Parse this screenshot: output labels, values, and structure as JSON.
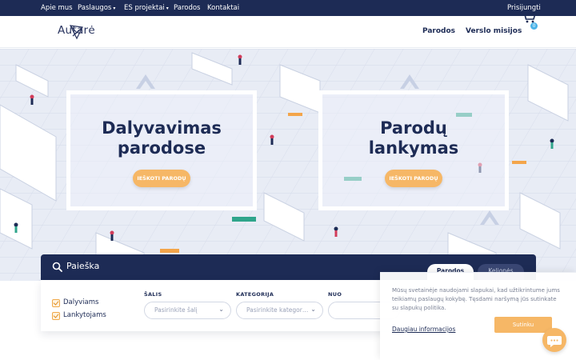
{
  "topbar": {
    "items": [
      {
        "label": "Apie mus",
        "dropdown": false
      },
      {
        "label": "Paslaugos",
        "dropdown": true
      },
      {
        "label": "ES projektai",
        "dropdown": true
      },
      {
        "label": "Parodos",
        "dropdown": false
      },
      {
        "label": "Kontaktai",
        "dropdown": false
      }
    ],
    "login": "Prisijungti"
  },
  "header": {
    "logo_text": "Autarė",
    "nav": [
      {
        "label": "Parodos"
      },
      {
        "label": "Verslo misijos"
      }
    ],
    "cart_count": "0"
  },
  "hero": {
    "cards": [
      {
        "title_line1": "Dalyvavimas",
        "title_line2": "parodose",
        "button": "IEŠKOTI PARODŲ"
      },
      {
        "title_line1": "Parodų",
        "title_line2": "lankymas",
        "button": "IEŠKOTI PARODŲ"
      }
    ]
  },
  "search": {
    "title": "Paieška",
    "tabs": [
      {
        "label": "Parodos",
        "active": true
      },
      {
        "label": "Kelionės",
        "active": false
      }
    ],
    "checkboxes": [
      {
        "label": "Dalyviams",
        "checked": true
      },
      {
        "label": "Lankytojams",
        "checked": true
      }
    ],
    "fields": [
      {
        "label": "ŠALIS",
        "placeholder": "Pasirinkite šalį"
      },
      {
        "label": "KATEGORIJA",
        "placeholder": "Pasirinkite kategoriją"
      },
      {
        "label": "NUO",
        "placeholder": ""
      }
    ]
  },
  "cookie": {
    "text": "Mūsų svetainėje naudojami slapukai, kad užtikrintume jums teikiamų paslaugų kokybę. Tęsdami naršymą jūs sutinkate su slapukų politika.",
    "link": "Daugiau informacijos",
    "button": "Sutinku"
  },
  "colors": {
    "navy": "#1d2b55",
    "accent": "#f6b766",
    "badge": "#4ab3e8"
  }
}
